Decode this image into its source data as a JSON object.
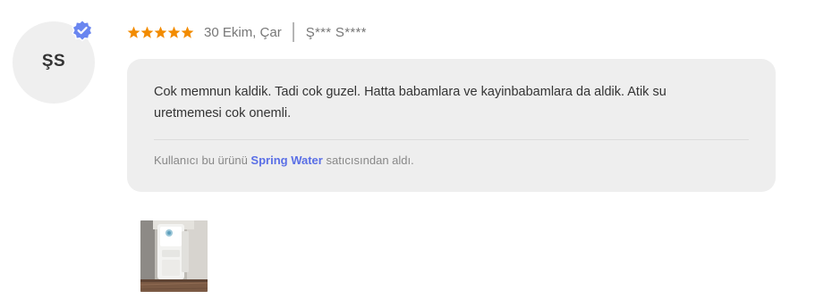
{
  "reviewer": {
    "initials": "ŞS",
    "name": "Ş*** S****",
    "verified": true,
    "verified_icon": "verified-check-badge-icon"
  },
  "review": {
    "rating": 5,
    "rating_max": 5,
    "star_icon": "star-icon",
    "date": "30 Ekim, Çar",
    "text": "Cok memnun kaldik. Tadi cok guzel. Hatta babamlara ve kayinbabamlara da aldik. Atik su uretmemesi cok onemli."
  },
  "seller_note": {
    "prefix": "Kullanıcı bu ürünü",
    "seller_name": "Spring Water",
    "suffix": "satıcısından aldı."
  },
  "photos": [
    {
      "kind": "product-photo-thumbnail"
    }
  ],
  "colors": {
    "star": "#f28b00",
    "badge": "#6a86f0",
    "seller_link": "#5a6fe6",
    "card_background": "#eeeeee",
    "avatar_background": "#efefef"
  }
}
